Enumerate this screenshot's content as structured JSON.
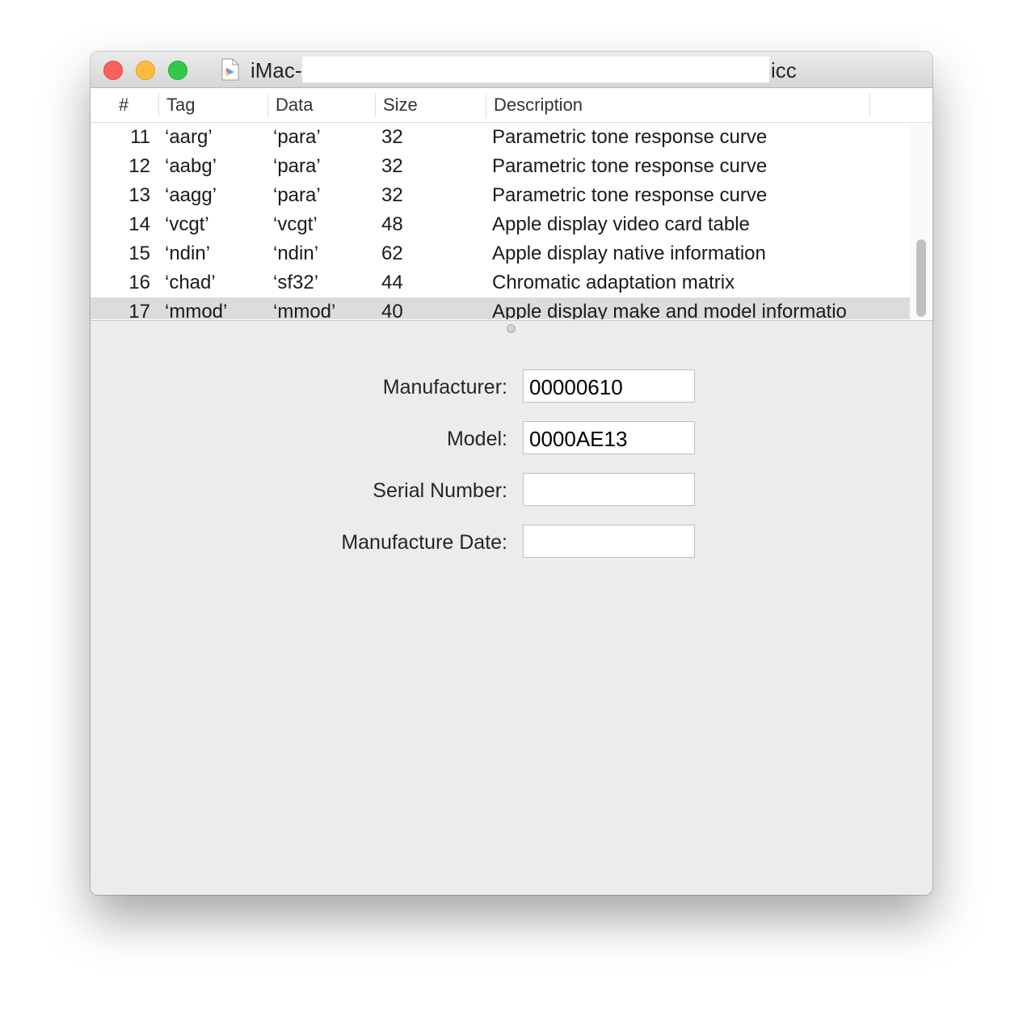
{
  "window": {
    "title_prefix": "iMac-",
    "title_suffix": "icc"
  },
  "table": {
    "columns": [
      "#",
      "Tag",
      "Data",
      "Size",
      "Description"
    ],
    "rows": [
      {
        "num": "11",
        "tag": "‘aarg’",
        "data": "‘para’",
        "size": "32",
        "description": "Parametric tone response curve"
      },
      {
        "num": "12",
        "tag": "‘aabg’",
        "data": "‘para’",
        "size": "32",
        "description": "Parametric tone response curve"
      },
      {
        "num": "13",
        "tag": "‘aagg’",
        "data": "‘para’",
        "size": "32",
        "description": "Parametric tone response curve"
      },
      {
        "num": "14",
        "tag": "‘vcgt’",
        "data": "‘vcgt’",
        "size": "48",
        "description": "Apple display video card table"
      },
      {
        "num": "15",
        "tag": "‘ndin’",
        "data": "‘ndin’",
        "size": "62",
        "description": "Apple display native information"
      },
      {
        "num": "16",
        "tag": "‘chad’",
        "data": "‘sf32’",
        "size": "44",
        "description": "Chromatic adaptation matrix"
      },
      {
        "num": "17",
        "tag": "‘mmod’",
        "data": "‘mmod’",
        "size": "40",
        "description": "Apple display make and model informatio"
      }
    ],
    "selected_row": "17"
  },
  "details": {
    "manufacturer_label": "Manufacturer:",
    "manufacturer_value": "00000610",
    "model_label": "Model:",
    "model_value": "0000AE13",
    "serial_label": "Serial Number:",
    "serial_value": "",
    "date_label": "Manufacture Date:",
    "date_value": ""
  },
  "colors": {
    "close": "#fc605c",
    "minimize": "#fdbc40",
    "zoom": "#34c84a",
    "selection": "#dcdcdc"
  }
}
